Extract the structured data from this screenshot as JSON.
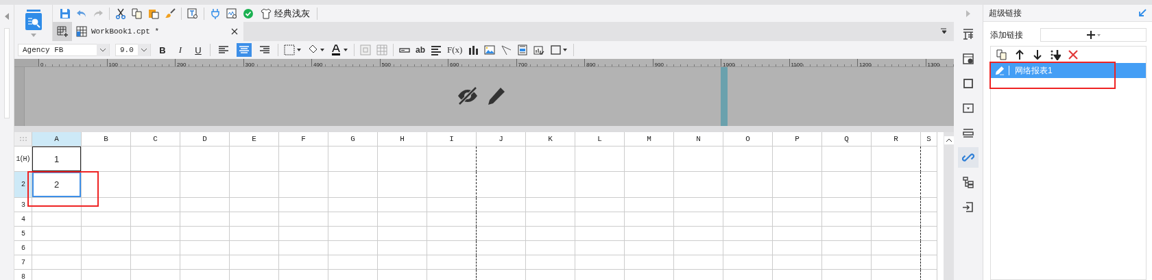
{
  "toolbar": {
    "theme_label": "经典浅灰"
  },
  "tabs": [
    {
      "label": "WorkBook1.cpt *",
      "selected": true
    }
  ],
  "format": {
    "font": "Agency FB",
    "size": "9.0",
    "styles": [
      "B",
      "I",
      "U"
    ],
    "alignments": [
      {
        "selected": false
      },
      {
        "selected": true
      },
      {
        "selected": false
      }
    ],
    "text_tool": "ab",
    "formula_tool": "F(x)"
  },
  "ruler": [
    "0",
    "100",
    "200",
    "300",
    "400",
    "500",
    "600",
    "700",
    "800",
    "900",
    "1000",
    "1100",
    "1200",
    "1300"
  ],
  "grid": {
    "columns": [
      {
        "label": "A",
        "selected": true
      },
      {
        "label": "B",
        "selected": false
      },
      {
        "label": "C",
        "selected": false
      },
      {
        "label": "D",
        "selected": false
      },
      {
        "label": "E",
        "selected": false
      },
      {
        "label": "F",
        "selected": false
      },
      {
        "label": "G",
        "selected": false
      },
      {
        "label": "H",
        "selected": false
      },
      {
        "label": "I",
        "selected": false
      },
      {
        "label": "J",
        "selected": false
      },
      {
        "label": "K",
        "selected": false
      },
      {
        "label": "L",
        "selected": false
      },
      {
        "label": "M",
        "selected": false
      },
      {
        "label": "N",
        "selected": false
      },
      {
        "label": "O",
        "selected": false
      },
      {
        "label": "P",
        "selected": false
      },
      {
        "label": "Q",
        "selected": false
      },
      {
        "label": "R",
        "selected": false
      },
      {
        "label": "S",
        "selected": false
      }
    ],
    "rows": [
      {
        "label": "1(H)",
        "selected": false,
        "cells": [
          {
            "text": "1",
            "selected": false
          }
        ]
      },
      {
        "label": "2",
        "selected": true,
        "cells": [
          {
            "text": "2",
            "selected": true
          }
        ]
      },
      {
        "label": "3",
        "selected": false,
        "cells": []
      },
      {
        "label": "4",
        "selected": false,
        "cells": []
      },
      {
        "label": "5",
        "selected": false,
        "cells": []
      },
      {
        "label": "6",
        "selected": false,
        "cells": []
      },
      {
        "label": "7",
        "selected": false,
        "cells": []
      },
      {
        "label": "8",
        "selected": false,
        "cells": []
      }
    ]
  },
  "side_tabs": [
    {
      "selected": false
    },
    {
      "selected": false
    },
    {
      "selected": false
    },
    {
      "selected": false
    },
    {
      "selected": false
    },
    {
      "selected": true
    },
    {
      "selected": false
    },
    {
      "selected": false
    }
  ],
  "panel": {
    "title": "超级链接",
    "add_label": "添加链接",
    "links": [
      {
        "label": "网络报表1",
        "selected": true
      }
    ]
  }
}
